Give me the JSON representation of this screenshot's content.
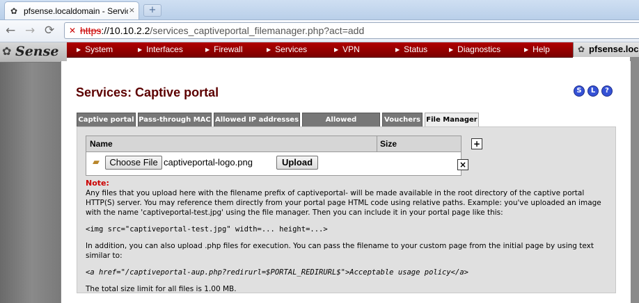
{
  "browser": {
    "tab_title": "pfsense.localdomain - Services: Capt",
    "tab_close": "×",
    "newtab": "+",
    "back": "←",
    "forward": "→",
    "reload": "⟳",
    "url_scheme": "https",
    "url_host": "://10.10.2.2",
    "url_path": "/services_captiveportal_filemanager.php?act=add"
  },
  "logo": {
    "text": "Sense"
  },
  "menu": [
    {
      "label": "System"
    },
    {
      "label": "Interfaces"
    },
    {
      "label": "Firewall"
    },
    {
      "label": "Services"
    },
    {
      "label": "VPN"
    },
    {
      "label": "Status"
    },
    {
      "label": "Diagnostics"
    },
    {
      "label": "Help"
    }
  ],
  "hostname": "pfsense.loc",
  "page": {
    "title": "Services: Captive portal",
    "help_icons": [
      "S",
      "L",
      "?"
    ]
  },
  "tabs": [
    {
      "label": "Captive portal"
    },
    {
      "label": "Pass-through MAC"
    },
    {
      "label": "Allowed IP addresses"
    },
    {
      "label": "Allowed Hostnames"
    },
    {
      "label": "Vouchers"
    },
    {
      "label": "File Manager",
      "active": true
    }
  ],
  "table": {
    "col_name": "Name",
    "col_size": "Size",
    "choose_file_label": "Choose File",
    "selected_file": "captiveportal-logo.png",
    "upload_label": "Upload"
  },
  "notes": {
    "label": "Note:",
    "p1": "Any files that you upload here with the filename prefix of captiveportal- will be made available in the root directory of the captive portal HTTP(S) server. You may reference them directly from your portal page HTML code using relative paths. Example: you've uploaded an image with the name 'captiveportal-test.jpg' using the file manager. Then you can include it in your portal page like this:",
    "code1": "<img src=\"captiveportal-test.jpg\" width=... height=...>",
    "p2": "In addition, you can also upload .php files for execution. You can pass the filename to your custom page from the initial page by using text similar to:",
    "code2": "<a href=\"/captiveportal-aup.php?redirurl=$PORTAL_REDIRURL$\">Acceptable usage policy</a>",
    "p3": "The total size limit for all files is 1.00 MB."
  }
}
